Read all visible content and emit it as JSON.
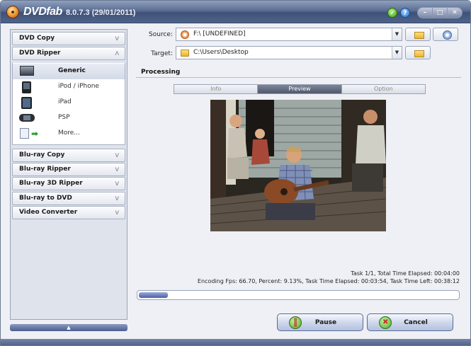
{
  "titlebar": {
    "brand": "DVDfab",
    "version": "8.0.7.3 (29/01/2011)",
    "check_icon": "check-circle-icon",
    "help_icon": "help-icon",
    "window_buttons": [
      "minimize",
      "maximize",
      "close"
    ],
    "window_glyphs": [
      "–",
      "□",
      "✕"
    ]
  },
  "sidebar": {
    "sections": [
      {
        "label": "DVD Copy",
        "expanded": false
      },
      {
        "label": "DVD Ripper",
        "expanded": true
      },
      {
        "label": "Blu-ray Copy",
        "expanded": false
      },
      {
        "label": "Blu-ray Ripper",
        "expanded": false
      },
      {
        "label": "Blu-ray 3D Ripper",
        "expanded": false
      },
      {
        "label": "Blu-ray to DVD",
        "expanded": false
      },
      {
        "label": "Video Converter",
        "expanded": false
      }
    ],
    "ripper_items": [
      {
        "label": "Generic",
        "icon": "monitor-icon",
        "selected": true
      },
      {
        "label": "iPod / iPhone",
        "icon": "ipod-icon",
        "selected": false
      },
      {
        "label": "iPad",
        "icon": "ipad-icon",
        "selected": false
      },
      {
        "label": "PSP",
        "icon": "psp-icon",
        "selected": false
      },
      {
        "label": "More...",
        "icon": "more-devices-icon",
        "selected": false
      }
    ],
    "chevron_down": "ᐯ",
    "chevron_up": "ᐱ",
    "collapse_glyph": "▲"
  },
  "source": {
    "label": "Source:",
    "value": "F:\\ [UNDEFINED]"
  },
  "target": {
    "label": "Target:",
    "value": "C:\\Users\\Desktop"
  },
  "dropdown_glyph": "▼",
  "processing": {
    "title": "Processing",
    "tabs": [
      {
        "label": "Info",
        "active": false
      },
      {
        "label": "Preview",
        "active": true
      },
      {
        "label": "Option",
        "active": false
      }
    ]
  },
  "stats": {
    "line1": "Task 1/1,  Total Time Elapsed: 00:04:00",
    "line2": "Encoding Fps: 66.70,  Percent: 9.13%,  Task Time Elapsed: 00:03:54,  Task Time Left: 00:38:12"
  },
  "progress": {
    "fraction": 0.0913
  },
  "buttons": {
    "pause": "Pause",
    "cancel": "Cancel"
  },
  "colors": {
    "accent": "#4f6389",
    "progress": "#4b5fa6"
  }
}
